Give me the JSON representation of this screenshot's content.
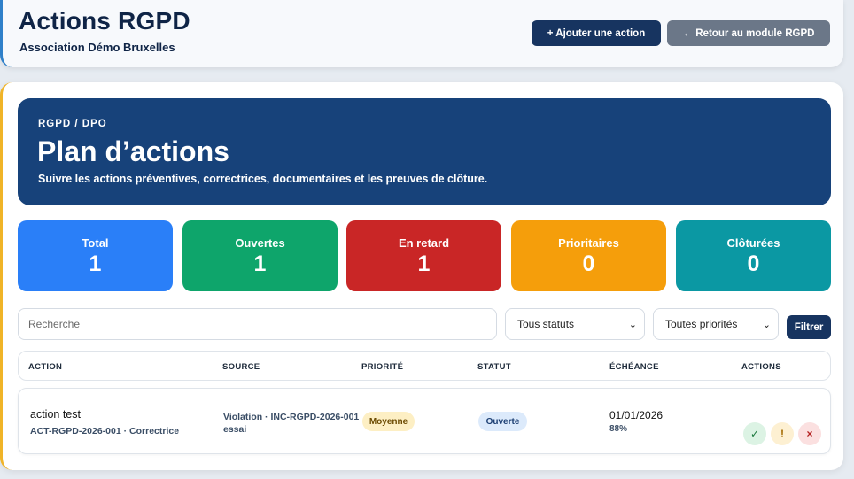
{
  "header": {
    "title": "Actions RGPD",
    "subtitle": "Association Démo Bruxelles",
    "add_button": "+ Ajouter une action",
    "back_button": "← Retour au module RGPD"
  },
  "hero": {
    "kicker": "RGPD / DPO",
    "title": "Plan d’actions",
    "description": "Suivre les actions préventives, correctrices, documentaires et les preuves de clôture."
  },
  "stats": [
    {
      "label": "Total",
      "value": "1",
      "color": "#2a7ff8"
    },
    {
      "label": "Ouvertes",
      "value": "1",
      "color": "#0ea56b"
    },
    {
      "label": "En retard",
      "value": "1",
      "color": "#c92626"
    },
    {
      "label": "Prioritaires",
      "value": "0",
      "color": "#f59e0b"
    },
    {
      "label": "Clôturées",
      "value": "0",
      "color": "#0b98a3"
    }
  ],
  "filters": {
    "search_placeholder": "Recherche",
    "status_selected": "Tous statuts",
    "priority_selected": "Toutes priorités",
    "filter_button": "Filtrer"
  },
  "table": {
    "headers": [
      "ACTION",
      "SOURCE",
      "PRIORITÉ",
      "STATUT",
      "ÉCHÉANCE",
      "ACTIONS"
    ],
    "rows": [
      {
        "title": "action test",
        "meta": "ACT-RGPD-2026-001 · Correctrice",
        "source": "Violation · INC-RGPD-2026-001 essai",
        "priority": "Moyenne",
        "status": "Ouverte",
        "due_date": "01/01/2026",
        "progress": "88%",
        "icons": [
          "check-icon",
          "exclamation-icon",
          "close-icon"
        ]
      }
    ]
  }
}
